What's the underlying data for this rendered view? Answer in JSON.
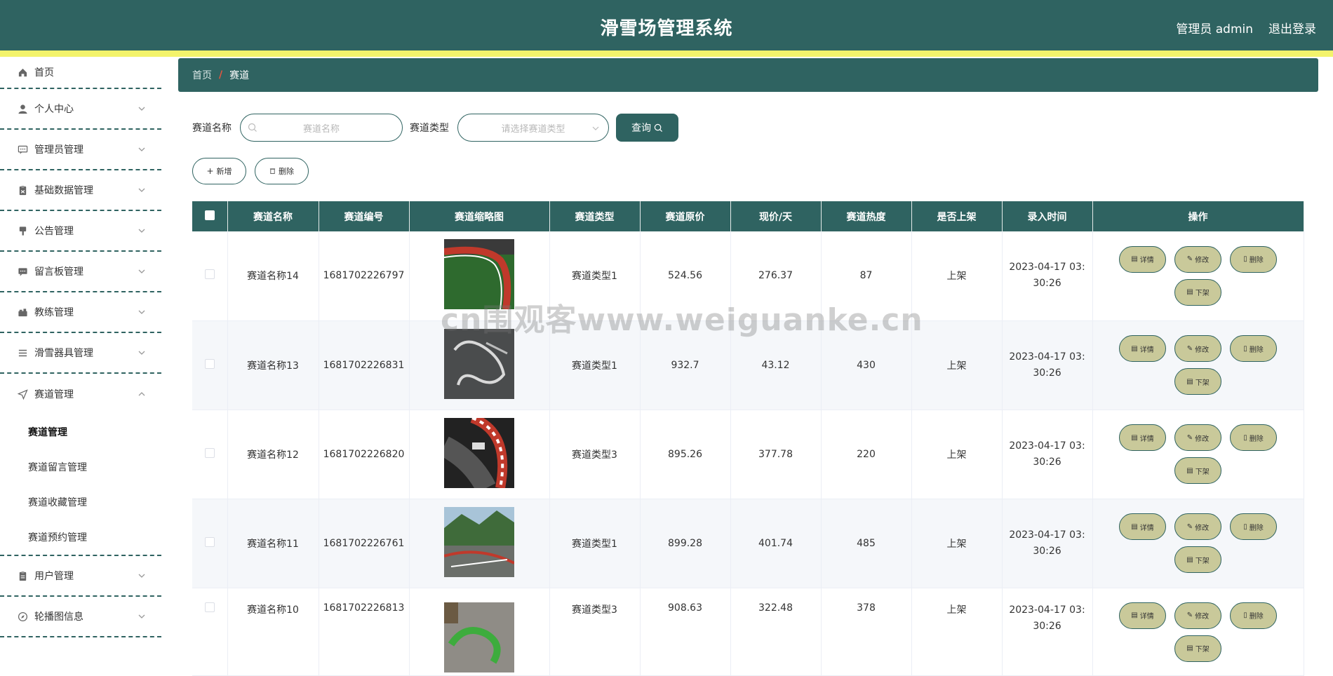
{
  "header": {
    "title": "滑雪场管理系统",
    "user": "管理员 admin",
    "logout": "退出登录"
  },
  "sidebar": {
    "items": [
      {
        "label": "首页",
        "icon": "home-icon"
      },
      {
        "label": "个人中心",
        "icon": "user-icon"
      },
      {
        "label": "管理员管理",
        "icon": "chat-icon"
      },
      {
        "label": "基础数据管理",
        "icon": "clipboard-icon"
      },
      {
        "label": "公告管理",
        "icon": "brush-icon"
      },
      {
        "label": "留言板管理",
        "icon": "message-icon"
      },
      {
        "label": "教练管理",
        "icon": "briefcase-icon"
      },
      {
        "label": "滑雪器具管理",
        "icon": "list-icon"
      },
      {
        "label": "赛道管理",
        "icon": "send-icon"
      },
      {
        "label": "用户管理",
        "icon": "document-icon"
      },
      {
        "label": "轮播图信息",
        "icon": "compass-icon"
      }
    ],
    "submenu": [
      "赛道管理",
      "赛道留言管理",
      "赛道收藏管理",
      "赛道预约管理"
    ]
  },
  "breadcrumb": {
    "home": "首页",
    "sep": "/",
    "current": "赛道"
  },
  "search": {
    "name_label": "赛道名称",
    "name_placeholder": "赛道名称",
    "type_label": "赛道类型",
    "type_placeholder": "请选择赛道类型",
    "query_label": "查询"
  },
  "actions": {
    "add": "新增",
    "delete": "删除"
  },
  "table": {
    "headers": [
      "赛道名称",
      "赛道编号",
      "赛道缩略图",
      "赛道类型",
      "赛道原价",
      "现价/天",
      "赛道热度",
      "是否上架",
      "录入时间",
      "操作"
    ],
    "op_labels": {
      "detail": "详情",
      "edit": "修改",
      "delete": "删除",
      "offline": "下架"
    },
    "rows": [
      {
        "name": "赛道名称14",
        "code": "1681702226797",
        "type": "赛道类型1",
        "orig": "524.56",
        "price": "276.37",
        "heat": "87",
        "status": "上架",
        "time1": "2023-04-17 03:",
        "time2": "30:26"
      },
      {
        "name": "赛道名称13",
        "code": "1681702226831",
        "type": "赛道类型1",
        "orig": "932.7",
        "price": "43.12",
        "heat": "430",
        "status": "上架",
        "time1": "2023-04-17 03:",
        "time2": "30:26"
      },
      {
        "name": "赛道名称12",
        "code": "1681702226820",
        "type": "赛道类型3",
        "orig": "895.26",
        "price": "377.78",
        "heat": "220",
        "status": "上架",
        "time1": "2023-04-17 03:",
        "time2": "30:26"
      },
      {
        "name": "赛道名称11",
        "code": "1681702226761",
        "type": "赛道类型1",
        "orig": "899.28",
        "price": "401.74",
        "heat": "485",
        "status": "上架",
        "time1": "2023-04-17 03:",
        "time2": "30:26"
      },
      {
        "name": "赛道名称10",
        "code": "1681702226813",
        "type": "赛道类型3",
        "orig": "908.63",
        "price": "322.48",
        "heat": "378",
        "status": "上架",
        "time1": "2023-04-17 03:",
        "time2": "30:26"
      }
    ]
  },
  "watermark": "cn围观客www.weiguanke.cn",
  "colors": {
    "primary": "#2f6361",
    "accent_stripe": "#f3f36b",
    "op_button": "#c9c99a",
    "breadcrumb_sep": "#e8553e"
  }
}
